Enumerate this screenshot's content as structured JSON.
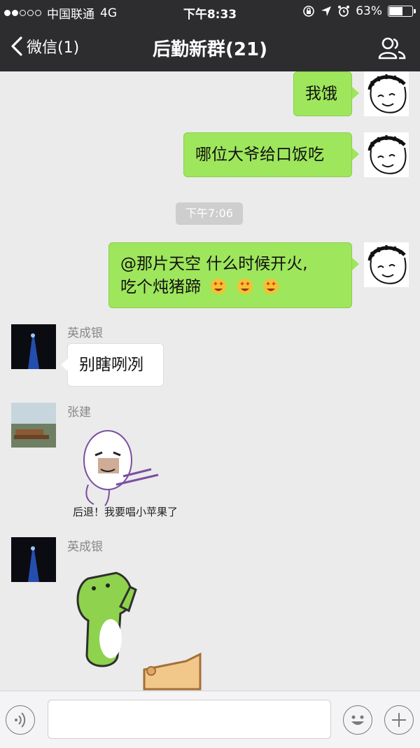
{
  "status_bar": {
    "carrier": "中国联通",
    "network": "4G",
    "time": "下午8:33",
    "battery": "63%",
    "battery_level": 0.63
  },
  "nav": {
    "back_label": "微信(1)",
    "title": "后勤新群(21)",
    "right_icon": "group-members-icon"
  },
  "messages": [
    {
      "sender": "me",
      "text": "我饿"
    },
    {
      "sender": "me",
      "text": "哪位大爷给口饭吃"
    },
    {
      "timestamp": "下午7:06"
    },
    {
      "sender": "me",
      "line1": "@那片天空 什么时候开火,",
      "line2": "吃个炖猪蹄",
      "emoji": "star-struck-face"
    },
    {
      "sender_name": "英成银",
      "text": "别瞎咧冽"
    },
    {
      "sender_name": "张建",
      "sticker_caption": "后退！我要唱小苹果了"
    },
    {
      "sender_name": "英成银",
      "sticker": "green-dog-sticker"
    }
  ],
  "input_bar": {
    "left_icon": "voice-icon",
    "input_value": "",
    "emoji_icon": "emoji-icon",
    "plus_icon": "plus-icon"
  },
  "colors": {
    "header_bg": "#2d2d2f",
    "chat_bg": "#ebebeb",
    "my_bubble": "#9ee65c",
    "other_bubble": "#ffffff"
  }
}
